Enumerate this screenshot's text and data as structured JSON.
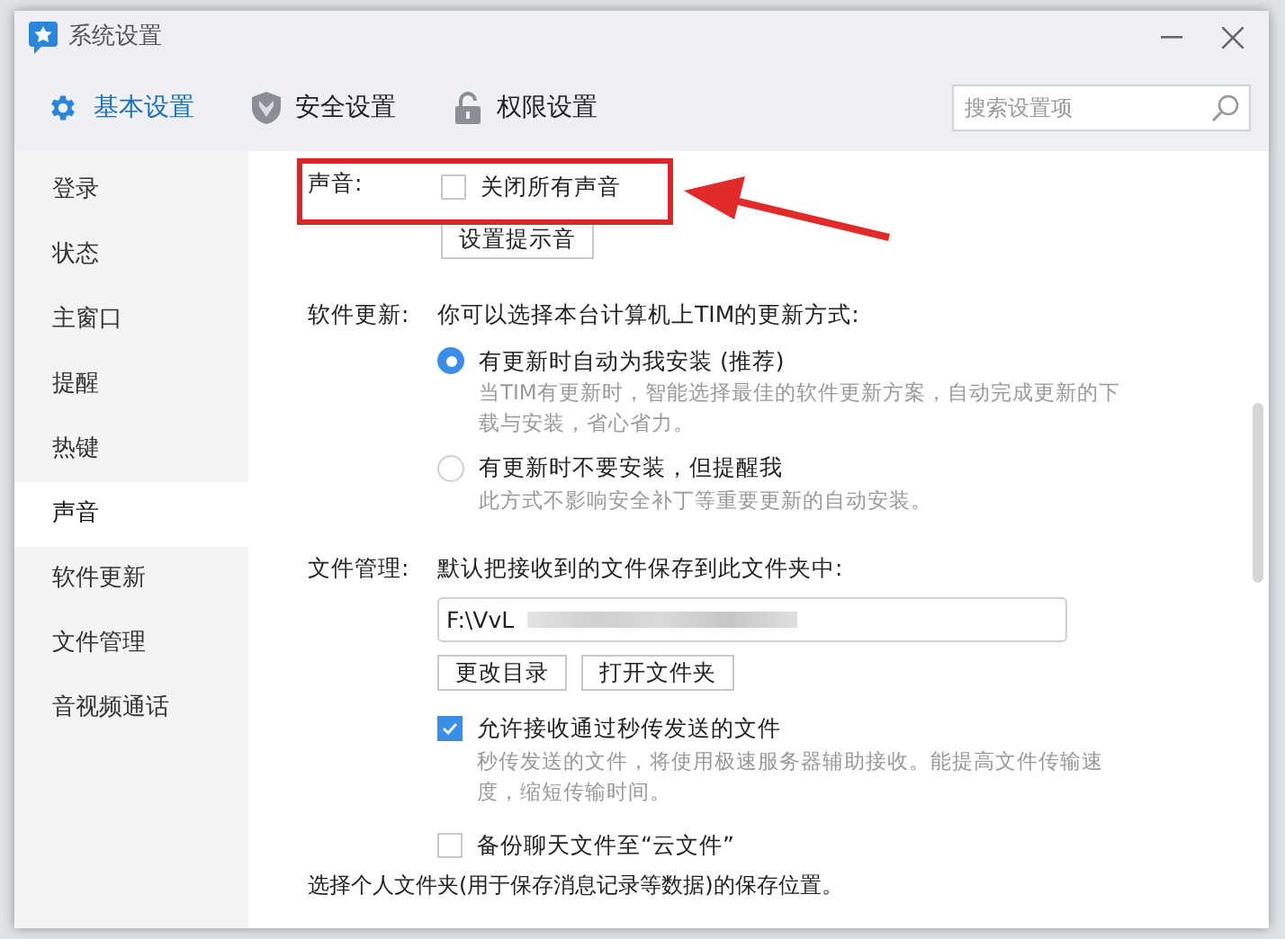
{
  "window": {
    "title": "系统设置"
  },
  "tabs": [
    {
      "label": "基本设置",
      "selected": true
    },
    {
      "label": "安全设置",
      "selected": false
    },
    {
      "label": "权限设置",
      "selected": false
    }
  ],
  "search": {
    "placeholder": "搜索设置项"
  },
  "sidebar": {
    "items": [
      {
        "label": "登录",
        "selected": false
      },
      {
        "label": "状态",
        "selected": false
      },
      {
        "label": "主窗口",
        "selected": false
      },
      {
        "label": "提醒",
        "selected": false
      },
      {
        "label": "热键",
        "selected": false
      },
      {
        "label": "声音",
        "selected": true
      },
      {
        "label": "软件更新",
        "selected": false
      },
      {
        "label": "文件管理",
        "selected": false
      },
      {
        "label": "音视频通话",
        "selected": false
      }
    ]
  },
  "sound": {
    "label": "声音:",
    "checkbox": {
      "label": "关闭所有声音",
      "checked": false
    },
    "button": "设置提示音"
  },
  "update": {
    "label": "软件更新:",
    "intro": "你可以选择本台计算机上TIM的更新方式:",
    "options": [
      {
        "label": "有更新时自动为我安装 (推荐)",
        "description": "当TIM有更新时，智能选择最佳的软件更新方案，自动完成更新的下载与安装，省心省力。",
        "selected": true
      },
      {
        "label": "有更新时不要安装，但提醒我",
        "description": "此方式不影响安全补丁等重要更新的自动安装。",
        "selected": false
      }
    ]
  },
  "files": {
    "label": "文件管理:",
    "intro": "默认把接收到的文件保存到此文件夹中:",
    "path": {
      "value": "F:\\VvL"
    },
    "buttons": [
      "更改目录",
      "打开文件夹"
    ],
    "options": [
      {
        "label": "允许接收通过秒传发送的文件",
        "description": "秒传发送的文件，将使用极速服务器辅助接收。能提高文件传输速度，缩短传输时间。",
        "checked": true
      },
      {
        "label": "备份聊天文件至“云文件”",
        "checked": false
      }
    ],
    "footer": "选择个人文件夹(用于保存消息记录等数据)的保存位置。"
  }
}
